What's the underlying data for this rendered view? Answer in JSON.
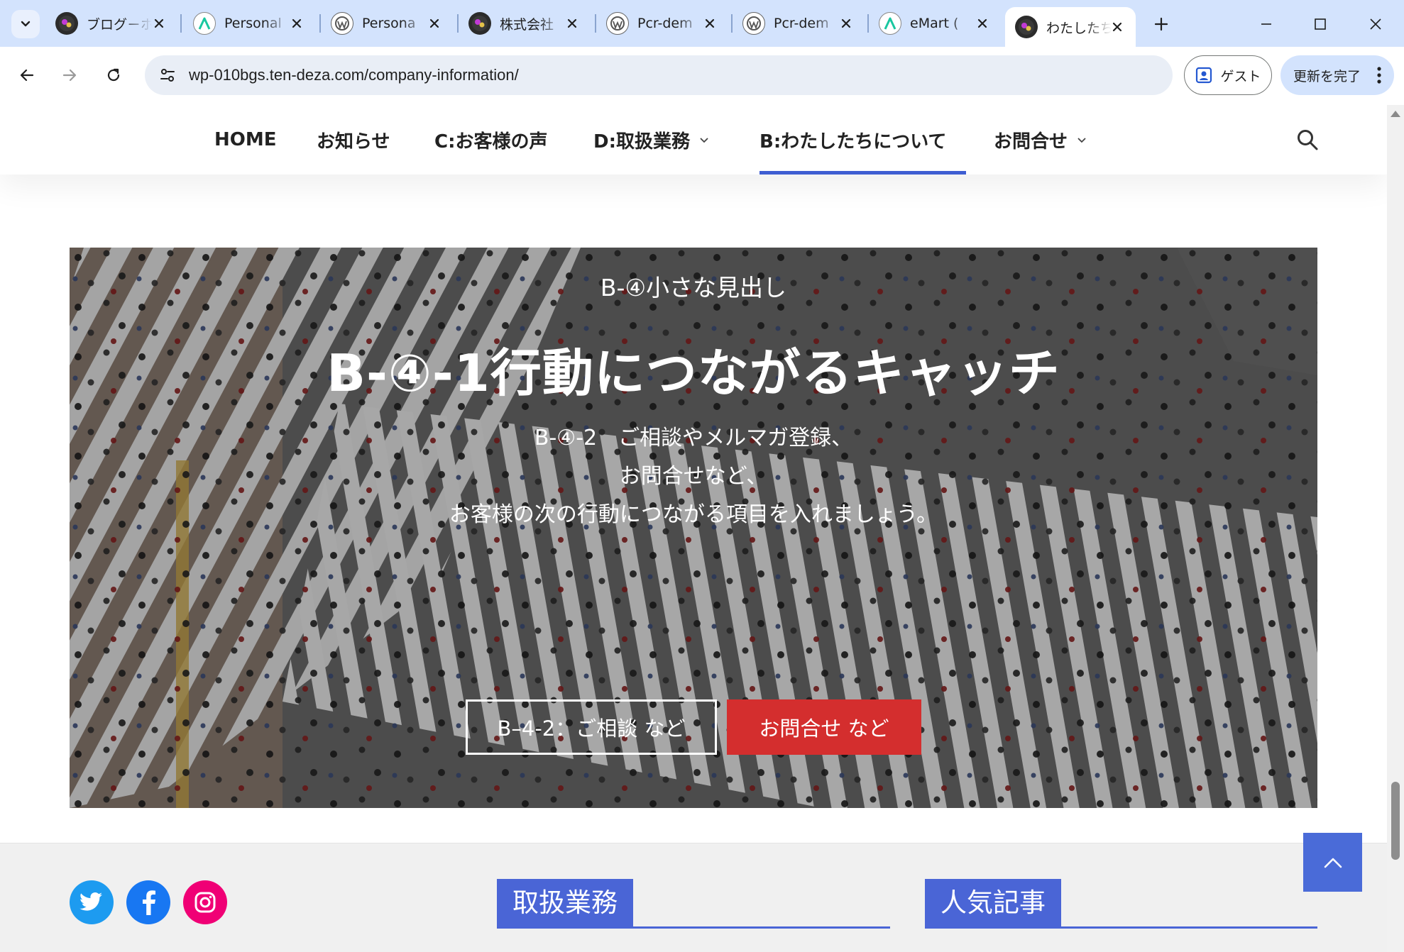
{
  "browser": {
    "tabs": [
      {
        "title": "ブログ－ホ",
        "favicon": "dark-logo"
      },
      {
        "title": "Personal",
        "favicon": "green-a-icon"
      },
      {
        "title": "Persona",
        "favicon": "wordpress-icon"
      },
      {
        "title": "株式会社",
        "favicon": "dark-logo"
      },
      {
        "title": "Pcr-dem",
        "favicon": "wordpress-icon"
      },
      {
        "title": "Pcr-dem",
        "favicon": "wordpress-icon"
      },
      {
        "title": "eMart (",
        "favicon": "green-a-icon"
      },
      {
        "title": "わたしたち",
        "favicon": "dark-logo",
        "active": true
      }
    ],
    "url": "wp-010bgs.ten-deza.com/company-information/",
    "guest_label": "ゲスト",
    "update_label": "更新を完了"
  },
  "nav": {
    "items": [
      {
        "label": "HOME"
      },
      {
        "label": "お知らせ"
      },
      {
        "label": "C:お客様の声"
      },
      {
        "label": "D:取扱業務",
        "has_dropdown": true
      },
      {
        "label": "B:わたしたちについて",
        "current": true
      },
      {
        "label": "お問合せ",
        "has_dropdown": true
      }
    ]
  },
  "hero": {
    "small_heading": "B-④小さな見出し",
    "catch": "B-④-1行動につながるキャッチ",
    "description": [
      "B-④-2　ご相談やメルマガ登録、",
      "お問合せなど、",
      "お客様の次の行動につながる項目を入れましょう。"
    ],
    "button_outline": "B–4-2：ご相談 など",
    "button_red": "お問合せ など"
  },
  "footer": {
    "widget_services": "取扱業務",
    "widget_popular": "人気記事",
    "social": [
      "twitter-icon",
      "facebook-icon",
      "instagram-icon"
    ]
  },
  "colors": {
    "accent": "#4a65d6",
    "red_button": "#d42e2e",
    "twitter": "#1d9bf0",
    "facebook": "#1877f2",
    "instagram": "#f00075"
  }
}
